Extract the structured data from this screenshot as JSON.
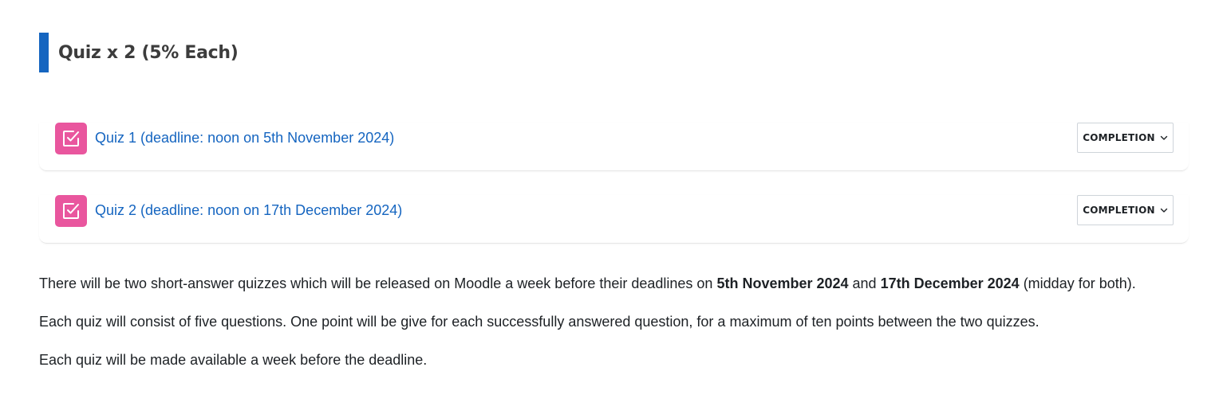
{
  "section": {
    "title": "Quiz x 2 (5% Each)",
    "accent_color": "#1565c0"
  },
  "activities": [
    {
      "icon": "quiz-checkbox-icon",
      "icon_color": "#e9569e",
      "title": "Quiz 1 (deadline: noon on 5th November 2024)",
      "completion_label": "COMPLETION"
    },
    {
      "icon": "quiz-checkbox-icon",
      "icon_color": "#e9569e",
      "title": "Quiz 2 (deadline: noon on 17th December 2024)",
      "completion_label": "COMPLETION"
    }
  ],
  "description": {
    "p1_a": "There will be two short-answer quizzes which will be released on Moodle a week before their deadlines on ",
    "p1_b": "5th November 2024",
    "p1_c": " and ",
    "p1_d": "17th December 2024",
    "p1_e": " (midday for both).",
    "p2": "Each quiz will consist of five questions. One point will be give for each successfully answered question, for a maximum of ten points between the two quizzes.",
    "p3": "Each quiz will be made available a week before the deadline."
  },
  "link_color": "#1565c0"
}
